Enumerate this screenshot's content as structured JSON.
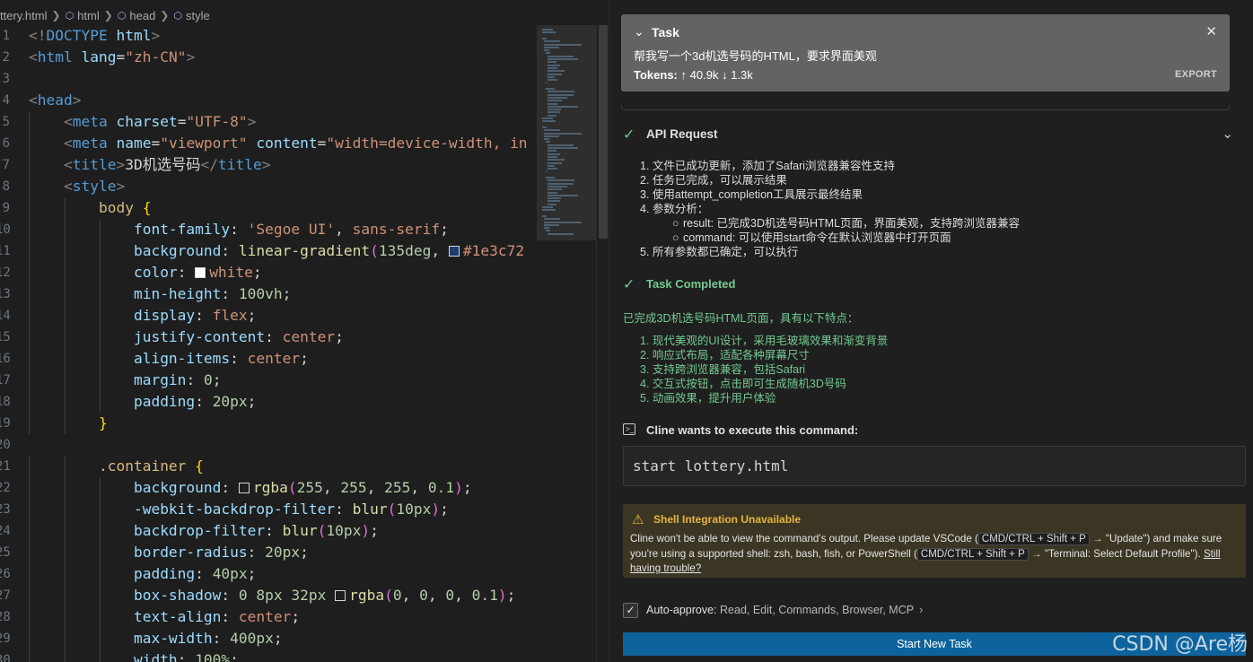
{
  "breadcrumb": [
    "ttery.html",
    "html",
    "head",
    "style"
  ],
  "code_lines": [
    {
      "n": "1",
      "text": "<!DOCTYPE html>"
    },
    {
      "n": "2",
      "text": "<html lang=\"zh-CN\">"
    },
    {
      "n": "3",
      "text": ""
    },
    {
      "n": "4",
      "text": "<head>"
    },
    {
      "n": "5",
      "text": "    <meta charset=\"UTF-8\">"
    },
    {
      "n": "6",
      "text": "    <meta name=\"viewport\" content=\"width=device-width, in"
    },
    {
      "n": "7",
      "text": "    <title>3D机选号码</title>"
    },
    {
      "n": "8",
      "text": "    <style>"
    },
    {
      "n": "9",
      "text": "        body {"
    },
    {
      "n": "10",
      "text": "            font-family: 'Segoe UI', sans-serif;"
    },
    {
      "n": "11",
      "text": "            background: linear-gradient(135deg, #1e3c72"
    },
    {
      "n": "12",
      "text": "            color: white;"
    },
    {
      "n": "13",
      "text": "            min-height: 100vh;"
    },
    {
      "n": "14",
      "text": "            display: flex;"
    },
    {
      "n": "15",
      "text": "            justify-content: center;"
    },
    {
      "n": "16",
      "text": "            align-items: center;"
    },
    {
      "n": "17",
      "text": "            margin: 0;"
    },
    {
      "n": "18",
      "text": "            padding: 20px;"
    },
    {
      "n": "19",
      "text": "        }"
    },
    {
      "n": "20",
      "text": ""
    },
    {
      "n": "21",
      "text": "        .container {"
    },
    {
      "n": "22",
      "text": "            background: rgba(255, 255, 255, 0.1);"
    },
    {
      "n": "23",
      "text": "            -webkit-backdrop-filter: blur(10px);"
    },
    {
      "n": "24",
      "text": "            backdrop-filter: blur(10px);"
    },
    {
      "n": "25",
      "text": "            border-radius: 20px;"
    },
    {
      "n": "26",
      "text": "            padding: 40px;"
    },
    {
      "n": "27",
      "text": "            box-shadow: 0 8px 32px rgba(0, 0, 0, 0.1);"
    },
    {
      "n": "28",
      "text": "            text-align: center;"
    },
    {
      "n": "29",
      "text": "            max-width: 400px;"
    },
    {
      "n": "30",
      "text": "            width: 100%;"
    }
  ],
  "swatches": {
    "line11": "#1e3c72",
    "line12": "#ffffff",
    "line22": "#1e1e1e",
    "line27": "#1e1e1e"
  },
  "task": {
    "title": "Task",
    "text": "帮我写一个3d机选号码的HTML，要求界面美观",
    "tokens_label": "Tokens:",
    "tokens_up": "40.9k",
    "tokens_down": "1.3k",
    "export_label": "EXPORT"
  },
  "api_request": {
    "title": "API Request",
    "items": [
      "1. 文件已成功更新，添加了Safari浏览器兼容性支持",
      "2. 任务已完成，可以展示结果",
      "3. 使用attempt_completion工具展示最终结果",
      "4. 参数分析：",
      "result: 已完成3D机选号码HTML页面，界面美观，支持跨浏览器兼容",
      "command: 可以使用start命令在默认浏览器中打开页面",
      "5. 所有参数都已确定，可以执行"
    ]
  },
  "completed": {
    "title": "Task Completed",
    "intro": "已完成3D机选号码HTML页面，具有以下特点：",
    "items": [
      "1. 现代美观的UI设计，采用毛玻璃效果和渐变背景",
      "2. 响应式布局，适配各种屏幕尺寸",
      "3. 支持跨浏览器兼容，包括Safari",
      "4. 交互式按钮，点击即可生成随机3D号码",
      "5. 动画效果，提升用户体验"
    ]
  },
  "command": {
    "title": "Cline wants to execute this command:",
    "text": "start lottery.html"
  },
  "warning": {
    "title": "Shell Integration Unavailable",
    "body_1": "Cline won't be able to view the command's output. Please update VSCode (",
    "kbd_1": "CMD/CTRL + Shift + P",
    "body_2": "→ \"Update\") and make sure you're using a supported shell: zsh, bash, fish, or PowerShell (",
    "kbd_2": "CMD/CTRL + Shift + P",
    "body_3": "→ \"Terminal: Select Default Profile\").",
    "link": "Still having trouble?"
  },
  "auto_approve": {
    "label": "Auto-approve:",
    "items": "Read, Edit, Commands, Browser, MCP"
  },
  "start_button": "Start New Task",
  "watermark": "CSDN @Are杨"
}
